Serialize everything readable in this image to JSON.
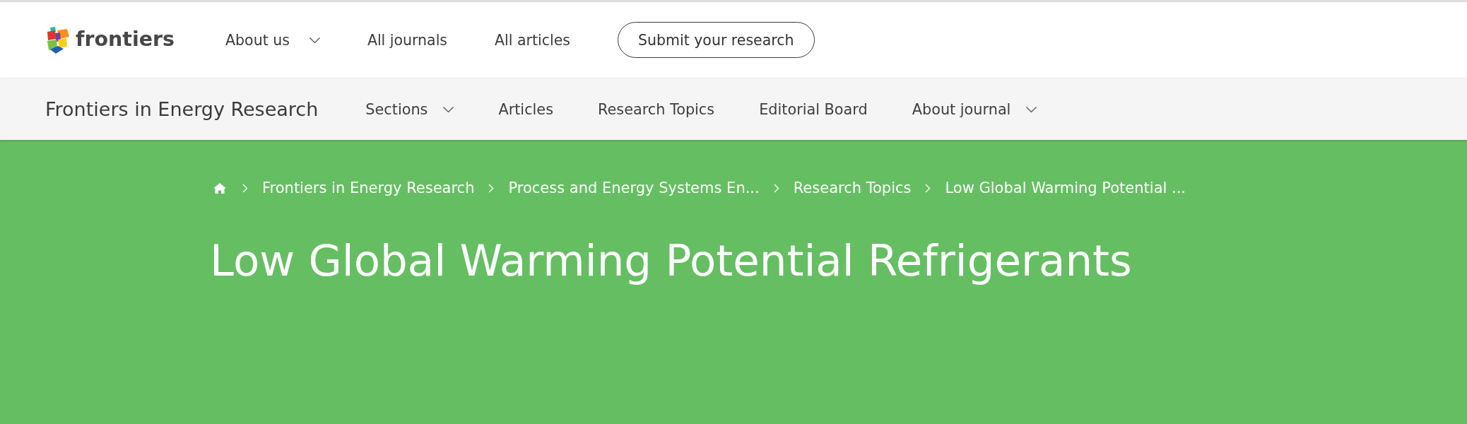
{
  "header": {
    "logo": {
      "text": "frontiers"
    },
    "nav": [
      {
        "label": "About us",
        "dropdown": true
      },
      {
        "label": "All journals",
        "dropdown": false
      },
      {
        "label": "All articles",
        "dropdown": false
      }
    ],
    "action_button": {
      "label": "Submit your research"
    }
  },
  "journal_nav": {
    "title": "Frontiers in Energy Research",
    "items": [
      {
        "label": "Sections",
        "dropdown": true
      },
      {
        "label": "Articles",
        "dropdown": false
      },
      {
        "label": "Research Topics",
        "dropdown": false
      },
      {
        "label": "Editorial Board",
        "dropdown": false
      },
      {
        "label": "About journal",
        "dropdown": true
      }
    ]
  },
  "hero": {
    "breadcrumb": [
      {
        "kind": "home"
      },
      {
        "kind": "link",
        "label": "Frontiers in Energy Research"
      },
      {
        "kind": "link",
        "label": "Process and Energy Systems En..."
      },
      {
        "kind": "link",
        "label": "Research Topics"
      },
      {
        "kind": "link",
        "label": "Low Global Warming Potential ..."
      }
    ],
    "title": "Low Global Warming Potential Refrigerants"
  }
}
